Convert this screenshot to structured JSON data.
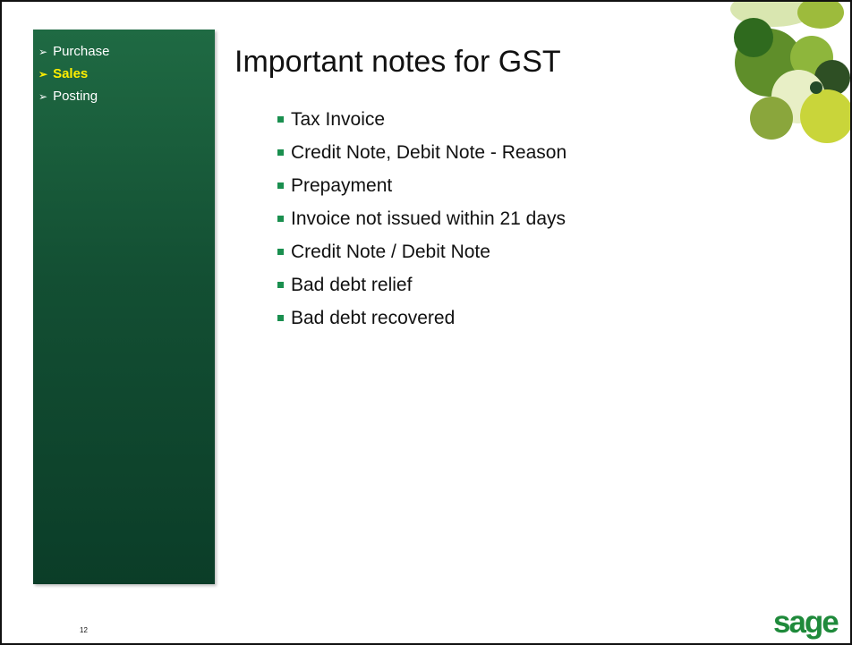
{
  "sidebar": {
    "items": [
      {
        "label": "Purchase",
        "active": false
      },
      {
        "label": "Sales",
        "active": true
      },
      {
        "label": "Posting",
        "active": false
      }
    ]
  },
  "title": "Important notes for GST",
  "bullets": [
    "Tax Invoice",
    "Credit Note, Debit Note - Reason",
    "Prepayment",
    "Invoice not issued within 21 days",
    "Credit Note / Debit Note",
    "Bad debt relief",
    "Bad debt recovered"
  ],
  "page_number": "12",
  "logo": "sage",
  "colors": {
    "sidebar": "#134f33",
    "active_nav": "#ffee00",
    "bullet": "#1a8f4f",
    "logo": "#1f8a3b"
  }
}
